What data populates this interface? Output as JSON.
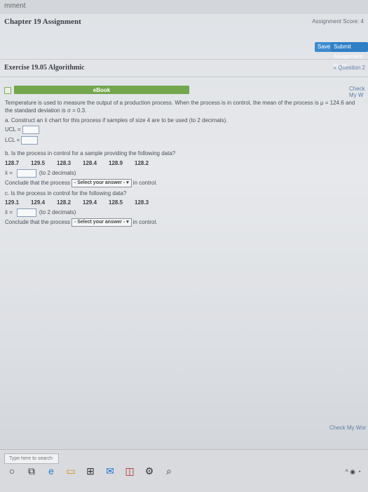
{
  "topbar": {
    "text": "mment"
  },
  "header": {
    "title": "Chapter 19 Assignment",
    "score_label": "Assignment Score: 4"
  },
  "actions": {
    "save": "Save",
    "submit": "Submit Assignment for Gr"
  },
  "exercise": {
    "title": "Exercise 19.05 Algorithmic",
    "question_nav": "« Question 2"
  },
  "check_my_work": "Check My W",
  "ebook_label": "eBook",
  "problem": {
    "intro": "Temperature is used to measure the output of a production process. When the process is in control, the mean of the process is μ = 124.6 and the standard deviation is σ = 0.3.",
    "part_a": "a. Construct an x̄ chart for this process if samples of size 4 are to be used (to 2 decimals).",
    "ucl_label": "UCL =",
    "lcl_label": "LCL =",
    "part_b": "b. Is the process in control for a sample providing the following data?",
    "sample_b": [
      "128.7",
      "129.5",
      "128.3",
      "128.4",
      "128.9",
      "128.2"
    ],
    "xbar_label": "x̄ =",
    "decimals_note": "(to 2 decimals)",
    "conclude_prefix": "Conclude that the process",
    "select_placeholder": "- Select your answer -",
    "conclude_suffix": "in control.",
    "part_c": "c. Is the process in control for the following data?",
    "sample_c": [
      "129.1",
      "129.4",
      "128.2",
      "129.4",
      "128.5",
      "128.3"
    ]
  },
  "footer_check": "Check My Wor",
  "taskbar": {
    "search_placeholder": "Type here to search"
  }
}
